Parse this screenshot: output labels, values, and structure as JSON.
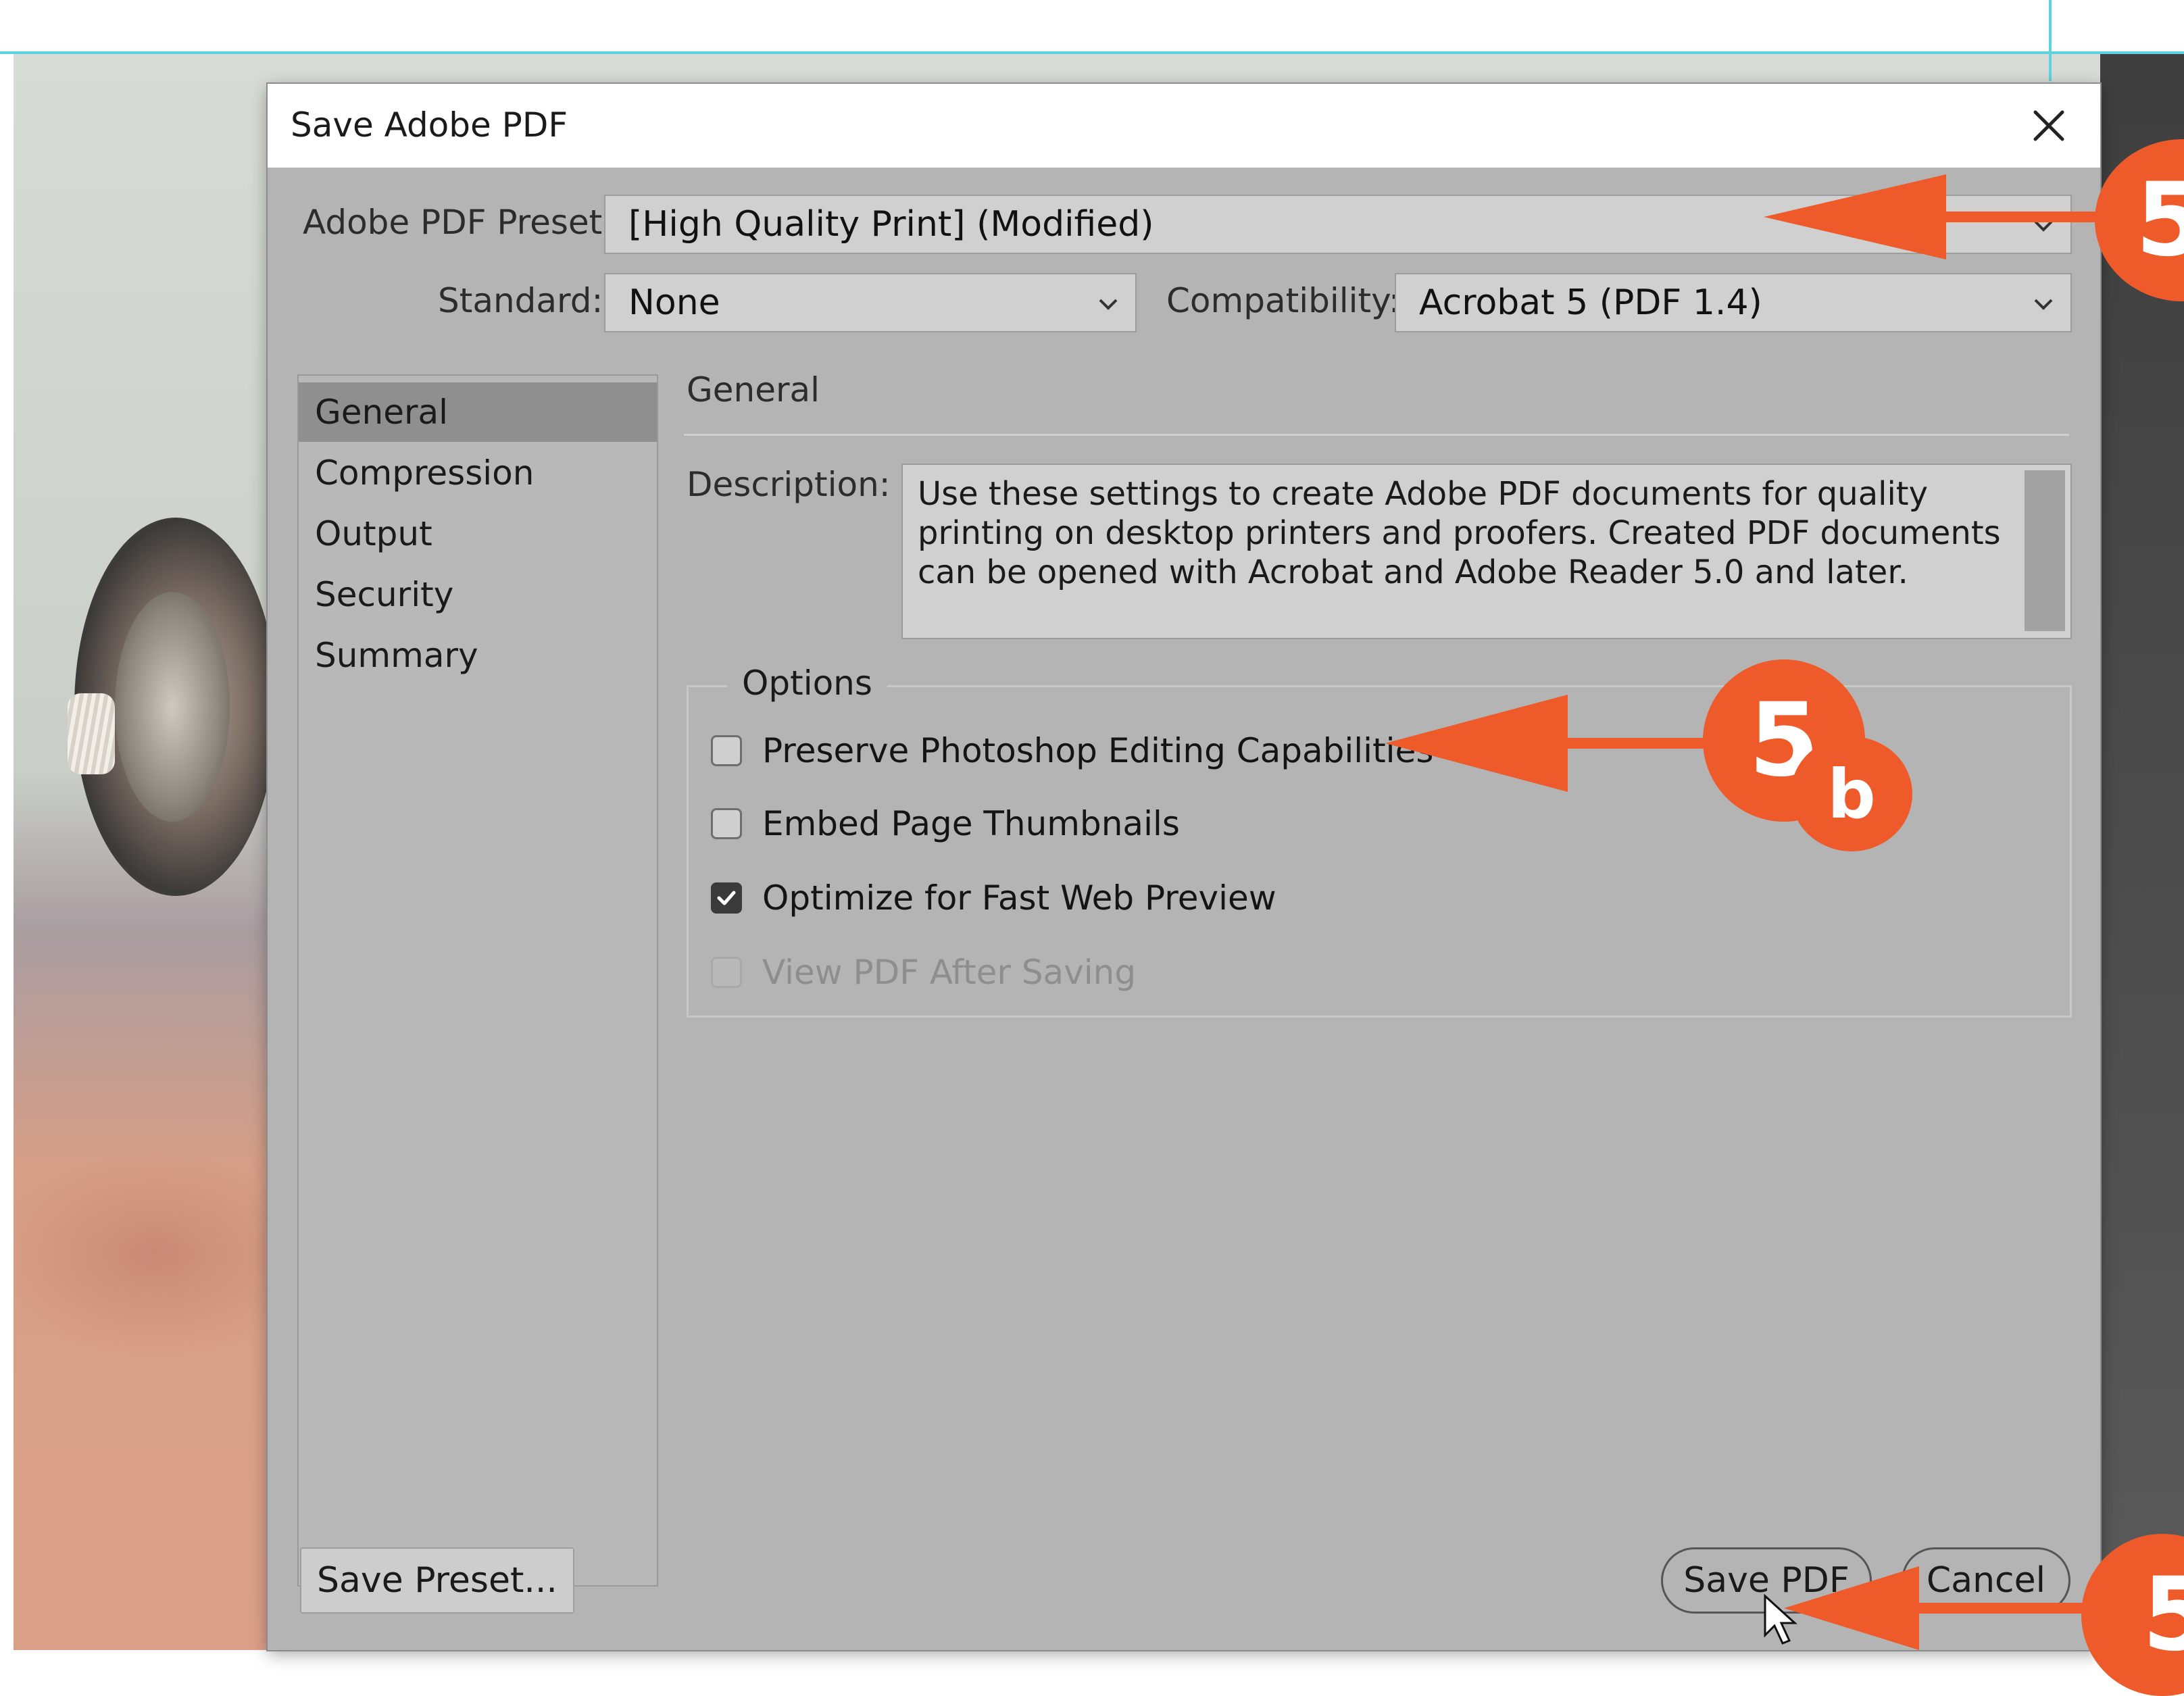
{
  "dialog": {
    "title": "Save Adobe PDF",
    "preset_label": "Adobe PDF Preset:",
    "preset_value": "[High Quality Print] (Modified)",
    "standard_label": "Standard:",
    "standard_value": "None",
    "compatibility_label": "Compatibility:",
    "compatibility_value": "Acrobat 5 (PDF 1.4)"
  },
  "sidebar": {
    "items": [
      {
        "label": "General",
        "selected": true
      },
      {
        "label": "Compression",
        "selected": false
      },
      {
        "label": "Output",
        "selected": false
      },
      {
        "label": "Security",
        "selected": false
      },
      {
        "label": "Summary",
        "selected": false
      }
    ]
  },
  "panel": {
    "heading": "General",
    "description_label": "Description:",
    "description_text": "Use these settings to create Adobe PDF documents for quality printing on desktop printers and proofers.  Created PDF documents can be opened with Acrobat and Adobe Reader 5.0 and later.",
    "options_legend": "Options",
    "options": [
      {
        "label": "Preserve Photoshop Editing Capabilities",
        "checked": false,
        "enabled": true
      },
      {
        "label": "Embed Page Thumbnails",
        "checked": false,
        "enabled": true
      },
      {
        "label": "Optimize for Fast Web Preview",
        "checked": true,
        "enabled": true
      },
      {
        "label": "View PDF After Saving",
        "checked": false,
        "enabled": false
      }
    ]
  },
  "buttons": {
    "save_preset": "Save Preset...",
    "save_pdf": "Save PDF",
    "cancel": "Cancel"
  },
  "annotations": {
    "callout_top": "5",
    "callout_mid_number": "5",
    "callout_mid_letter": "b",
    "callout_bottom": "5",
    "color": "#ee5a2a"
  },
  "icons": {
    "close": "close-icon",
    "dropdown": "chevron-down-icon",
    "checkbox_check": "checkmark-icon"
  }
}
